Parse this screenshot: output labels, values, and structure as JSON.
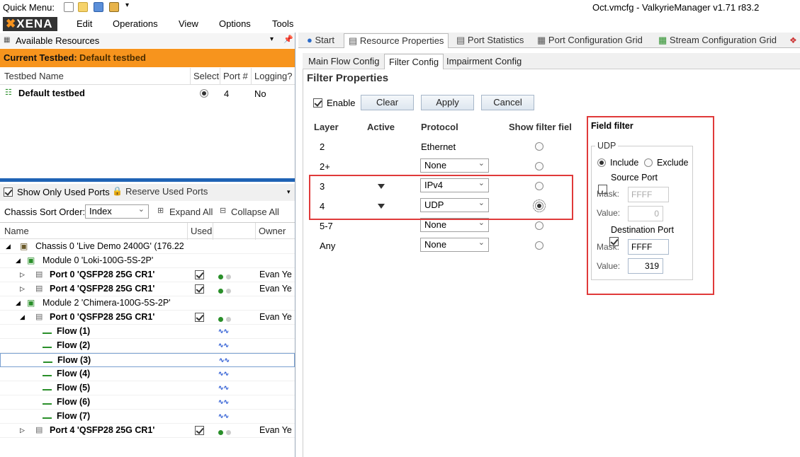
{
  "quick_menu": {
    "label": "Quick Menu:",
    "icons": [
      "new-icon",
      "open-icon",
      "save-icon",
      "export-icon",
      "dropdown-icon"
    ]
  },
  "window_title": "Oct.vmcfg - ValkyrieManager v1.71 r83.2",
  "logo_text": "XENA",
  "menu": [
    "Edit",
    "Operations",
    "View",
    "Options",
    "Tools"
  ],
  "left": {
    "panel_title": "Available Resources",
    "current_testbed_label": "Current Testbed:",
    "current_testbed_value": "Default testbed",
    "testbed_columns": [
      "Testbed Name",
      "Select",
      "Port #",
      "Logging?"
    ],
    "testbed_row": {
      "name": "Default testbed",
      "port_count": "4",
      "logging": "No"
    },
    "show_only_used": "Show Only Used Ports",
    "reserve_used": "Reserve Used Ports",
    "sort_label": "Chassis Sort Order:",
    "sort_value": "Index",
    "expand_all": "Expand All",
    "collapse_all": "Collapse All",
    "tree_columns": [
      "Name",
      "Used",
      "",
      "Owner"
    ],
    "tree": [
      {
        "text": "Chassis 0 'Live Demo 2400G' (176.22",
        "indent": 0,
        "kind": "chassis",
        "bold": false,
        "owner": ""
      },
      {
        "text": "Module 0 'Loki-100G-5S-2P'",
        "indent": 1,
        "kind": "module",
        "bold": false,
        "owner": ""
      },
      {
        "text": "Port 0 'QSFP28 25G CR1'",
        "indent": 2,
        "kind": "port",
        "bold": true,
        "owner": "Evan Ye"
      },
      {
        "text": "Port 4 'QSFP28 25G CR1'",
        "indent": 2,
        "kind": "port",
        "bold": true,
        "owner": "Evan Ye"
      },
      {
        "text": "Module 2 'Chimera-100G-5S-2P'",
        "indent": 1,
        "kind": "module",
        "bold": false,
        "owner": ""
      },
      {
        "text": "Port 0 'QSFP28 25G CR1'",
        "indent": 2,
        "kind": "port",
        "bold": true,
        "owner": "Evan Ye"
      },
      {
        "text": "Flow (1)",
        "indent": 3,
        "kind": "flow",
        "bold": true,
        "owner": ""
      },
      {
        "text": "Flow (2)",
        "indent": 3,
        "kind": "flow",
        "bold": true,
        "owner": ""
      },
      {
        "text": "Flow (3)",
        "indent": 3,
        "kind": "flow",
        "bold": true,
        "owner": ""
      },
      {
        "text": "Flow (4)",
        "indent": 3,
        "kind": "flow",
        "bold": true,
        "owner": ""
      },
      {
        "text": "Flow (5)",
        "indent": 3,
        "kind": "flow",
        "bold": true,
        "owner": ""
      },
      {
        "text": "Flow (6)",
        "indent": 3,
        "kind": "flow",
        "bold": true,
        "owner": ""
      },
      {
        "text": "Flow (7)",
        "indent": 3,
        "kind": "flow",
        "bold": true,
        "owner": ""
      },
      {
        "text": "Port 4 'QSFP28 25G CR1'",
        "indent": 2,
        "kind": "port",
        "bold": true,
        "owner": "Evan Ye"
      }
    ]
  },
  "tabs": [
    "Start",
    "Resource Properties",
    "Port Statistics",
    "Port Configuration Grid",
    "Stream Configuration Grid"
  ],
  "subtabs": [
    "Main Flow Config",
    "Filter Config",
    "Impairment Config"
  ],
  "filter": {
    "title": "Filter Properties",
    "enable_label": "Enable",
    "buttons": [
      "Clear",
      "Apply",
      "Cancel"
    ],
    "columns": [
      "Layer",
      "Active",
      "Protocol",
      "Show filter fiel"
    ],
    "rows": [
      {
        "layer": "2",
        "protocol": "Ethernet",
        "combo": false
      },
      {
        "layer": "2+",
        "protocol": "None",
        "combo": true
      },
      {
        "layer": "3",
        "protocol": "IPv4",
        "combo": true
      },
      {
        "layer": "4",
        "protocol": "UDP",
        "combo": true
      },
      {
        "layer": "5-7",
        "protocol": "None",
        "combo": true
      },
      {
        "layer": "Any",
        "protocol": "None",
        "combo": true
      }
    ]
  },
  "field_filter": {
    "title": "Field filter",
    "group": "UDP",
    "include": "Include",
    "exclude": "Exclude",
    "source_port": "Source Port",
    "mask_label": "Mask:",
    "value_label": "Value:",
    "src_mask": "FFFF",
    "src_value": "0",
    "dest_port": "Destination Port",
    "dst_mask": "FFFF",
    "dst_value": "319"
  },
  "colors": {
    "accent_orange": "#f7941d",
    "highlight_red": "#e03a3a",
    "splitter_blue": "#1f63b5"
  }
}
